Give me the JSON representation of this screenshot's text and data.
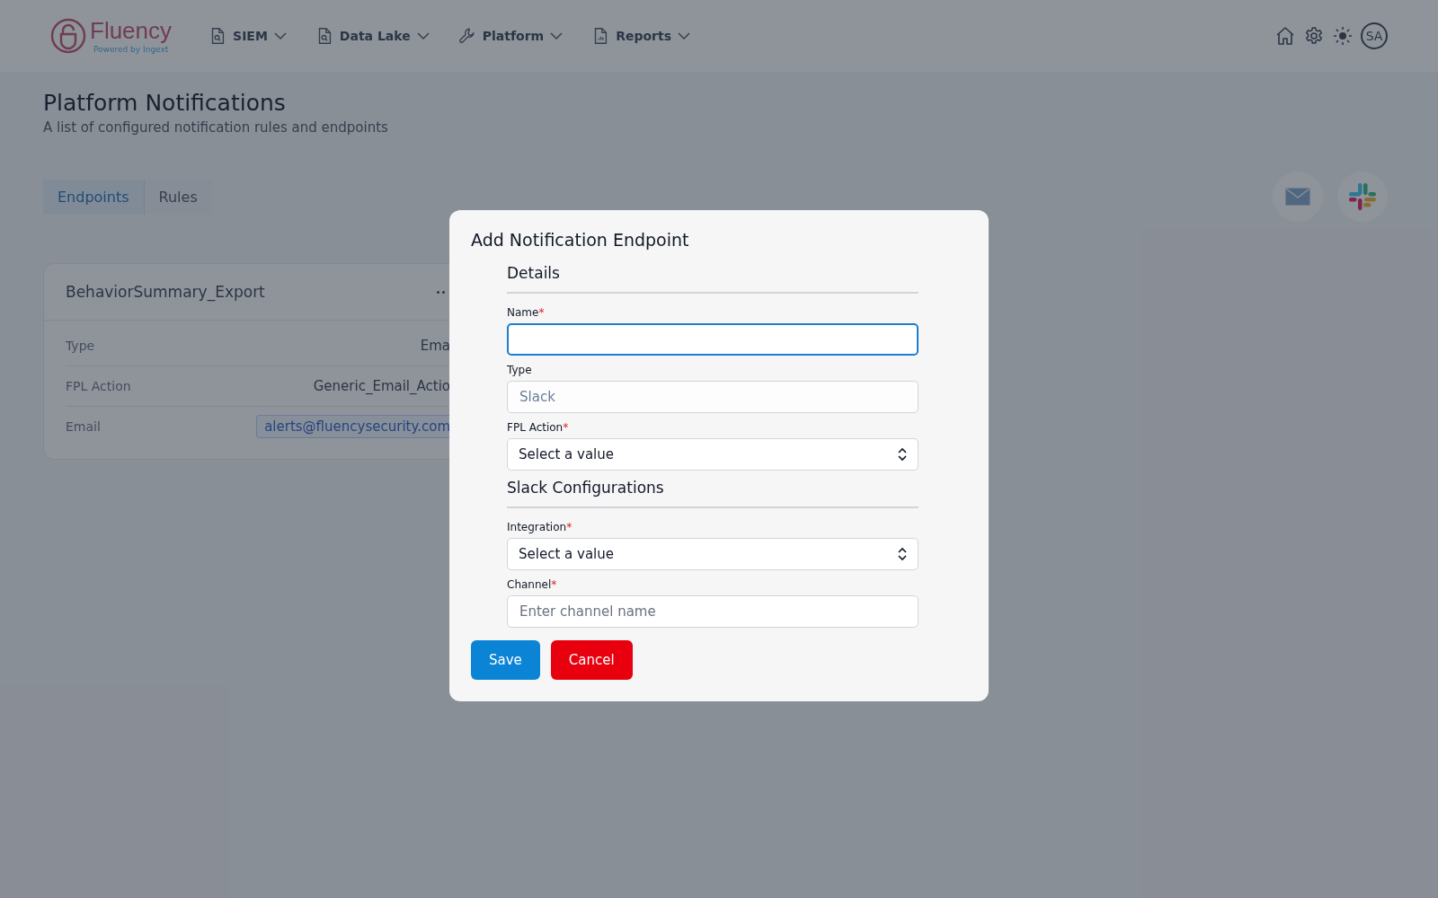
{
  "header": {
    "logo": {
      "name": "Fluency",
      "tagline": "Powered by Ingext"
    },
    "nav": [
      {
        "label": "SIEM"
      },
      {
        "label": "Data Lake"
      },
      {
        "label": "Platform"
      },
      {
        "label": "Reports"
      }
    ],
    "avatar": "SA"
  },
  "page": {
    "title": "Platform Notifications",
    "subtitle": "A list of configured notification rules and endpoints",
    "tabs": [
      {
        "label": "Endpoints",
        "selected": true
      },
      {
        "label": "Rules",
        "selected": false
      }
    ],
    "endpoint_card": {
      "title": "BehaviorSummary_Export",
      "rows": [
        {
          "label": "Type",
          "value": "Ema",
          "kind": "text"
        },
        {
          "label": "FPL Action",
          "value": "Generic_Email_Actio",
          "kind": "text"
        },
        {
          "label": "Email",
          "value": "alerts@fluencysecurity.com",
          "kind": "chip"
        }
      ]
    }
  },
  "modal": {
    "title": "Add Notification Endpoint",
    "sections": [
      {
        "title": "Details",
        "fields": [
          {
            "label": "Name",
            "required_mark": "*",
            "kind": "input",
            "focused": true
          },
          {
            "label": "Type",
            "kind": "input",
            "value": "Slack",
            "focused": false,
            "disabled": true
          },
          {
            "label": "FPL Action",
            "required_mark": "*",
            "kind": "select",
            "value": "Select a value"
          }
        ]
      },
      {
        "title": "Slack Configurations",
        "fields": [
          {
            "label": "Integration",
            "required_mark": "*",
            "kind": "select",
            "value": "Select a value"
          },
          {
            "label": "Channel",
            "required_mark": "*",
            "kind": "input",
            "placeholder": "Enter channel name",
            "focused": false
          }
        ]
      }
    ],
    "buttons": [
      {
        "label": "Save",
        "kind": "primary"
      },
      {
        "label": "Cancel",
        "kind": "danger"
      }
    ]
  }
}
